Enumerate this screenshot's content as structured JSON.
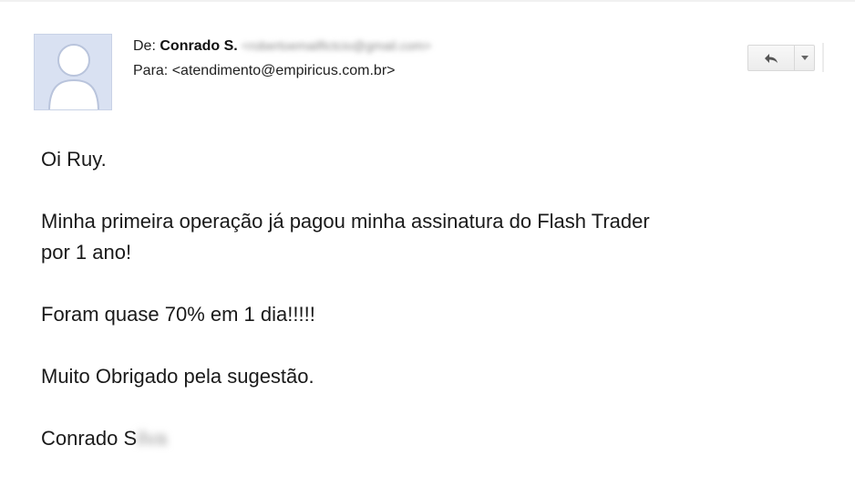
{
  "header": {
    "from_label": "De:",
    "from_name": "Conrado S.",
    "from_email_redacted": "<robertoemailfictcio@gmail.com>",
    "to_label": "Para:",
    "to_address": "<atendimento@empiricus.com.br>"
  },
  "actions": {
    "reply_icon": "reply-arrow-icon",
    "more_icon": "chevron-down-icon"
  },
  "message": {
    "greeting": "Oi Ruy.",
    "paragraph1_line1": "Minha primeira operação já pagou minha assinatura do Flash Trader",
    "paragraph1_line2": "por 1 ano!",
    "paragraph2": "Foram quase 70% em 1 dia!!!!!",
    "paragraph3": "Muito Obrigado pela sugestão.",
    "signature_visible": "Conrado S",
    "signature_redacted": "ilva"
  }
}
